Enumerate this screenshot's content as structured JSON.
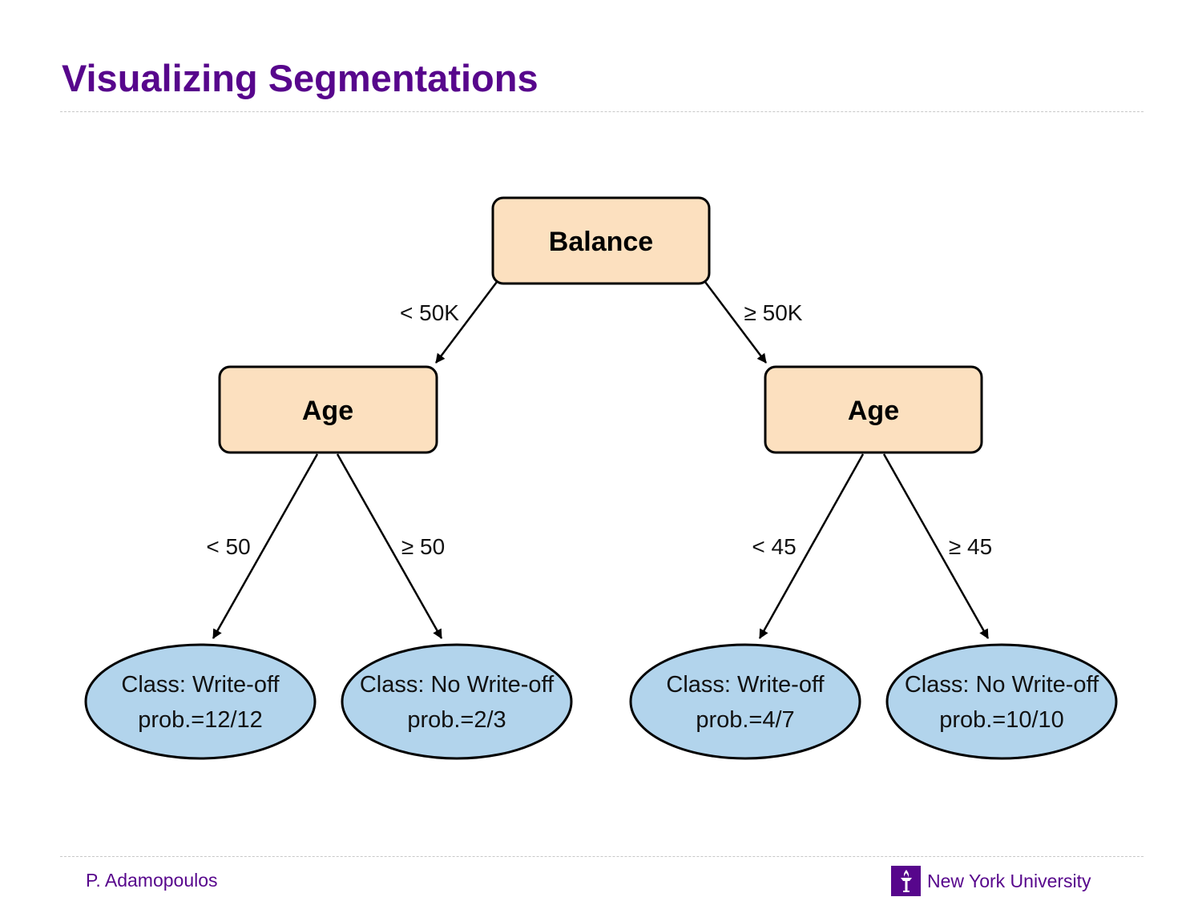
{
  "slide": {
    "title": "Visualizing Segmentations"
  },
  "tree": {
    "root": {
      "label": "Balance"
    },
    "left": {
      "edge_label": "< 50K",
      "label": "Age",
      "children": [
        {
          "edge_label": "< 50",
          "class_text": "Class: Write-off",
          "prob_text": "prob.=12/12"
        },
        {
          "edge_label": "≥ 50",
          "class_text": "Class: No Write-off",
          "prob_text": "prob.=2/3"
        }
      ]
    },
    "right": {
      "edge_label": "≥ 50K",
      "label": "Age",
      "children": [
        {
          "edge_label": "< 45",
          "class_text": "Class: Write-off",
          "prob_text": "prob.=4/7"
        },
        {
          "edge_label": "≥ 45",
          "class_text": "Class: No Write-off",
          "prob_text": "prob.=10/10"
        }
      ]
    }
  },
  "colors": {
    "decision_fill": "#fce0bf",
    "leaf_fill": "#b2d4ec",
    "stroke": "#000000",
    "accent": "#57068c"
  },
  "footer": {
    "author": "P. Adamopoulos",
    "institution": "New York University",
    "logo_icon": "torch-icon"
  }
}
